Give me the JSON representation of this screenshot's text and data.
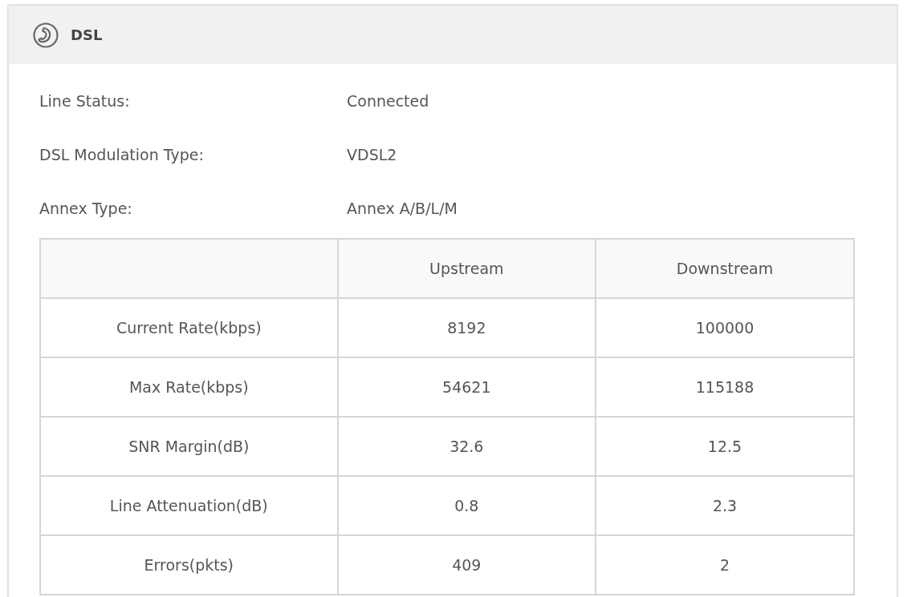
{
  "panel": {
    "title": "DSL"
  },
  "info": [
    {
      "label": "Line Status:",
      "value": "Connected"
    },
    {
      "label": "DSL Modulation Type:",
      "value": "VDSL2"
    },
    {
      "label": "Annex Type:",
      "value": "Annex A/B/L/M"
    }
  ],
  "table": {
    "columns": [
      "",
      "Upstream",
      "Downstream"
    ],
    "rows": [
      [
        "Current Rate(kbps)",
        "8192",
        "100000"
      ],
      [
        "Max Rate(kbps)",
        "54621",
        "115188"
      ],
      [
        "SNR Margin(dB)",
        "32.6",
        "12.5"
      ],
      [
        "Line Attenuation(dB)",
        "0.8",
        "2.3"
      ],
      [
        "Errors(pkts)",
        "409",
        "2"
      ]
    ]
  }
}
